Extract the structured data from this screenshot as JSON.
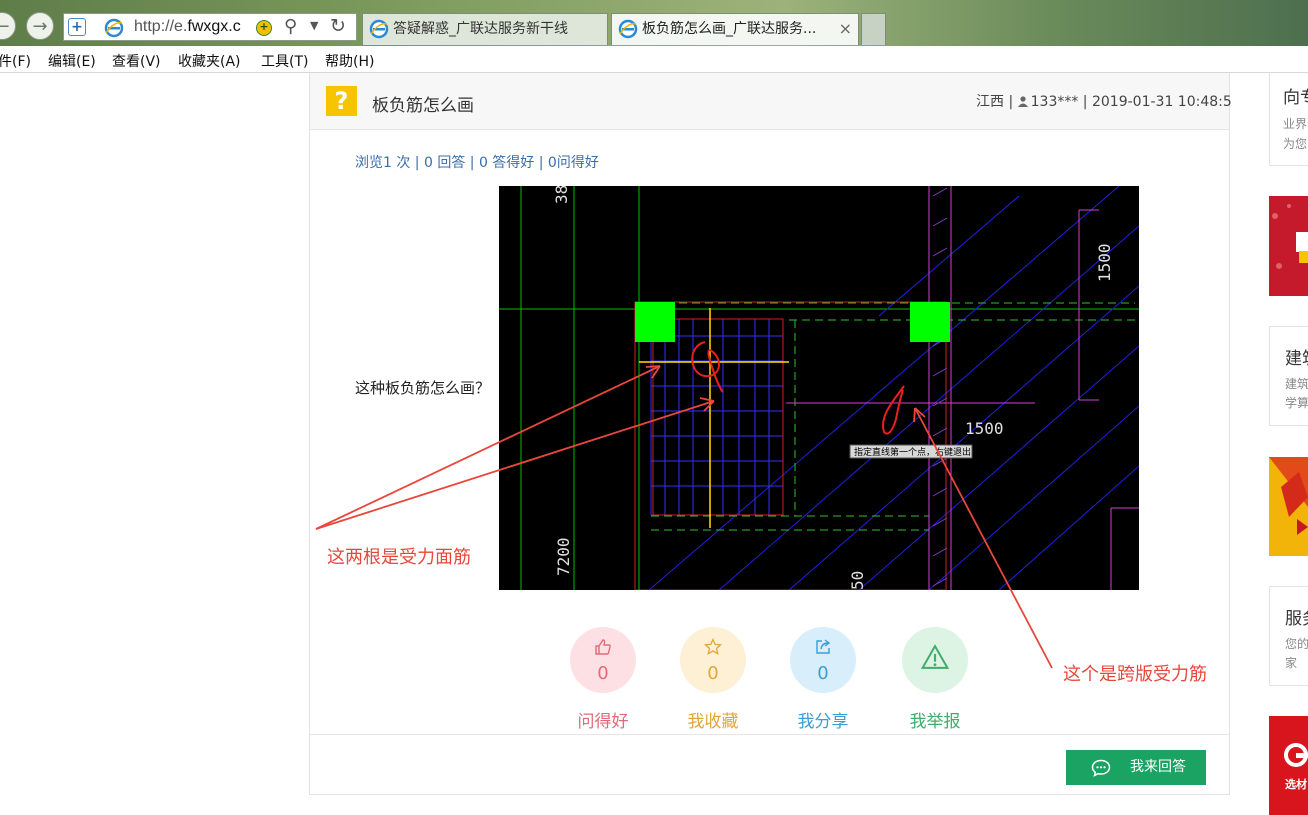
{
  "browser": {
    "url_prefix": "http://e.",
    "url_domain": "fwxgx.c",
    "tabs": [
      {
        "label": "答疑解惑_广联达服务新干线"
      },
      {
        "label": "板负筋怎么画_广联达服务..."
      }
    ],
    "tab_close": "×",
    "menu": [
      "件(F)",
      "编辑(E)",
      "查看(V)",
      "收藏夹(A)",
      "工具(T)",
      "帮助(H)"
    ]
  },
  "question": {
    "icon_char": "?",
    "title": "板负筋怎么画",
    "region": "江西",
    "user": "133***",
    "datetime": "2019-01-31 10:48:5",
    "stats": "浏览1 次 | 0 回答 | 0 答得好 | 0问得好",
    "body": "这种板负筋怎么画？"
  },
  "cad": {
    "dim_top": "38",
    "dim_right": "1500",
    "dim_mid": "1500",
    "dim_left": "7200",
    "dim_bottom": "50",
    "tooltip": "指定直线第一个点，右键退出"
  },
  "annotations": {
    "left": "这两根是受力面筋",
    "right": "这个是跨版受力筋",
    "color": "#e8473c"
  },
  "actions": [
    {
      "count": "0",
      "label": "问得好",
      "color": "#e26a78",
      "bg": "#fde0e4"
    },
    {
      "count": "0",
      "label": "我收藏",
      "color": "#e0a73c",
      "bg": "#fdf0d4"
    },
    {
      "count": "0",
      "label": "我分享",
      "color": "#3a9fd6",
      "bg": "#d8eefb"
    },
    {
      "count": "0",
      "label": "我举报",
      "color": "#3fae6a",
      "bg": "#ddf3e4"
    }
  ],
  "answer_button": "我来回答",
  "sidebar": [
    {
      "title": "向专",
      "sub1": "业界",
      "sub2": "为您"
    },
    {
      "title": "建筑",
      "sub1": "建筑",
      "sub2": "学算"
    },
    {
      "title": "服务",
      "sub1": "您的",
      "sub2": "家"
    }
  ],
  "sidebar_logo_text": "选材"
}
